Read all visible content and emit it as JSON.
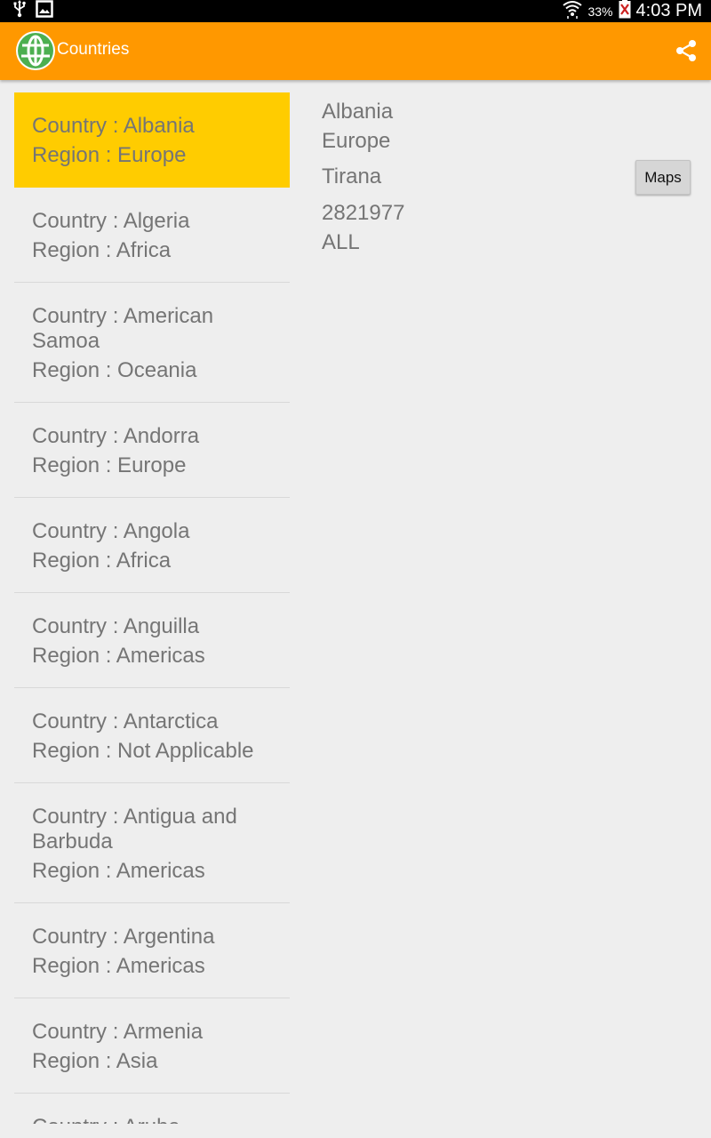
{
  "status_bar": {
    "battery_percent": "33%",
    "time": "4:03 PM",
    "icons": [
      "usb-icon",
      "image-notification-icon",
      "wifi-icon",
      "battery-icon"
    ]
  },
  "action_bar": {
    "title": "Countries",
    "app_icon": "globe-icon",
    "share_icon": "share-icon",
    "color": "#ff9800"
  },
  "countries": [
    {
      "country": "Country : Albania",
      "region": "Region : Europe",
      "selected": true
    },
    {
      "country": "Country : Algeria",
      "region": "Region : Africa"
    },
    {
      "country": "Country : American Samoa",
      "region": "Region : Oceania"
    },
    {
      "country": "Country : Andorra",
      "region": "Region : Europe"
    },
    {
      "country": "Country : Angola",
      "region": "Region : Africa"
    },
    {
      "country": "Country : Anguilla",
      "region": "Region : Americas"
    },
    {
      "country": "Country : Antarctica",
      "region": "Region : Not Applicable"
    },
    {
      "country": "Country : Antigua and Barbuda",
      "region": "Region : Americas"
    },
    {
      "country": "Country : Argentina",
      "region": "Region : Americas"
    },
    {
      "country": "Country : Armenia",
      "region": "Region : Asia"
    },
    {
      "country": "Country : Aruba",
      "region": ""
    }
  ],
  "detail": {
    "name": "Albania",
    "region": "Europe",
    "capital": "Tirana",
    "population": "2821977",
    "currency": "ALL",
    "maps_label": "Maps"
  },
  "colors": {
    "selected_row": "#ffcc00",
    "text": "#757575",
    "background": "#eeeeee"
  }
}
